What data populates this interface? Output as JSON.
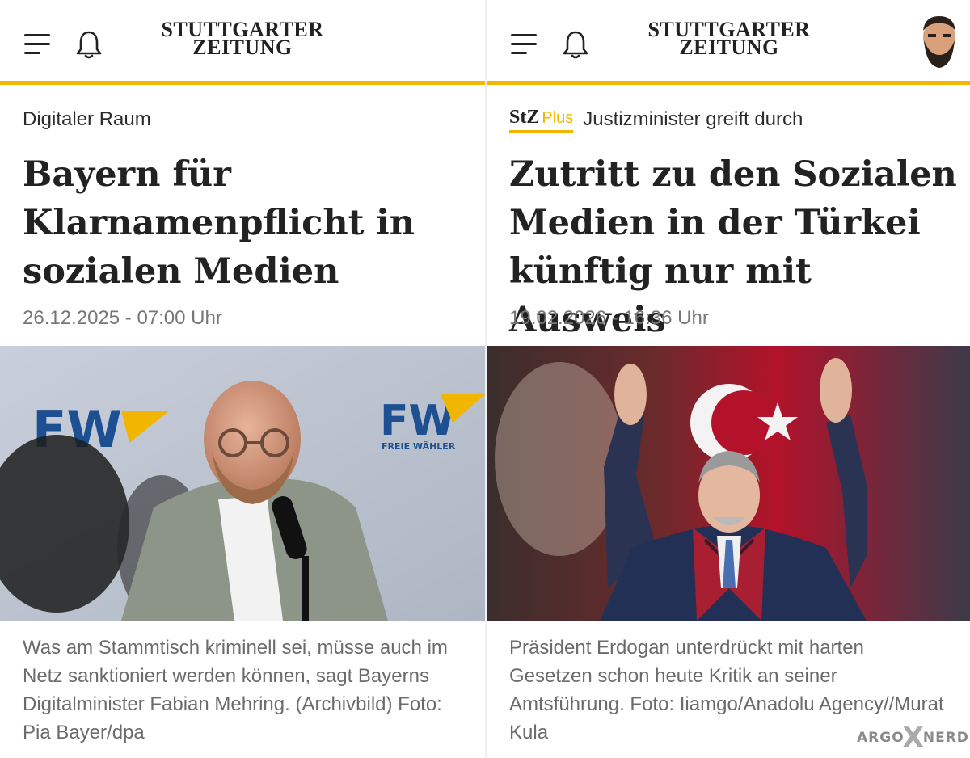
{
  "left": {
    "brand": {
      "line1": "STUTTGARTER",
      "line2": "ZEITUNG"
    },
    "kicker": "Digitaler Raum",
    "headline": "Bayern für Klarnamenpflicht in sozialen Medien",
    "date": "26.12.2025 - 07:00 Uhr",
    "photo": {
      "banner_text": "FW",
      "banner_subtext": "FREIE WÄHLER"
    },
    "caption": "Was am Stammtisch kriminell sei, müsse auch im Netz sanktioniert werden können, sagt Bayerns Digitalminister Fabian Mehring. (Archivbild) Foto: Pia Bayer/dpa"
  },
  "right": {
    "brand": {
      "line1": "STUTTGARTER",
      "line2": "ZEITUNG"
    },
    "plus_badge": {
      "stz": "StZ",
      "plus": "Plus"
    },
    "kicker": "Justizminister greift durch",
    "headline": "Zutritt zu den Sozialen Medien in der Türkei künftig nur mit Ausweis",
    "date": "19.02.2026 - 16:36 Uhr",
    "caption": "Präsident Erdogan unterdrückt mit harten Gesetzen schon heute Kritik an seiner Amtsführung. Foto: Iiamgo/Anadolu Agency//Murat Kula"
  },
  "watermark": {
    "left": "ARGO",
    "x": "X",
    "right": "NERD"
  },
  "colors": {
    "accent": "#f2b500",
    "text": "#222222",
    "muted": "#777777"
  },
  "icons": [
    "menu-icon",
    "bell-icon",
    "avatar-icon"
  ]
}
